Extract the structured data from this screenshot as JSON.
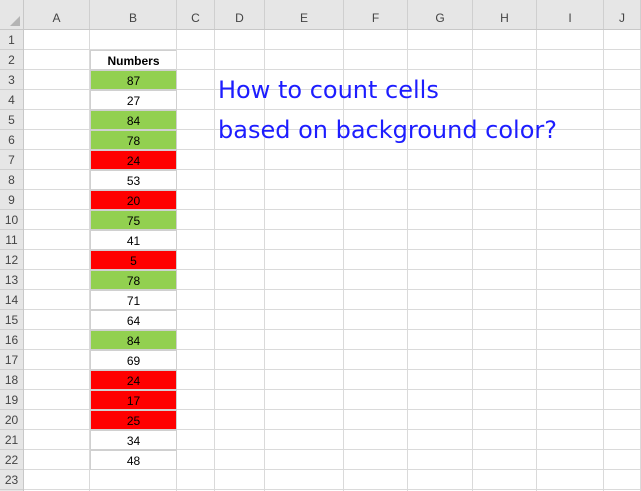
{
  "sheet": {
    "columns": [
      "A",
      "B",
      "C",
      "D",
      "E",
      "F",
      "G",
      "H",
      "I",
      "J"
    ],
    "rows": [
      "1",
      "2",
      "3",
      "4",
      "5",
      "6",
      "7",
      "8",
      "9",
      "10",
      "11",
      "12",
      "13",
      "14",
      "15",
      "16",
      "17",
      "18",
      "19",
      "20",
      "21",
      "22",
      "23"
    ]
  },
  "table": {
    "header": "Numbers",
    "colors": {
      "green": "#92d050",
      "red": "#ff0000",
      "white": "#ffffff"
    },
    "values": [
      {
        "value": "87",
        "color": "green"
      },
      {
        "value": "27",
        "color": "white"
      },
      {
        "value": "84",
        "color": "green"
      },
      {
        "value": "78",
        "color": "green"
      },
      {
        "value": "24",
        "color": "red"
      },
      {
        "value": "53",
        "color": "white"
      },
      {
        "value": "20",
        "color": "red"
      },
      {
        "value": "75",
        "color": "green"
      },
      {
        "value": "41",
        "color": "white"
      },
      {
        "value": "5",
        "color": "red"
      },
      {
        "value": "78",
        "color": "green"
      },
      {
        "value": "71",
        "color": "white"
      },
      {
        "value": "64",
        "color": "white"
      },
      {
        "value": "84",
        "color": "green"
      },
      {
        "value": "69",
        "color": "white"
      },
      {
        "value": "24",
        "color": "red"
      },
      {
        "value": "17",
        "color": "red"
      },
      {
        "value": "25",
        "color": "red"
      },
      {
        "value": "34",
        "color": "white"
      },
      {
        "value": "48",
        "color": "white"
      }
    ]
  },
  "headline": {
    "line1": "How to count cells",
    "line2": "based on background color?",
    "color": "#1d1dff"
  }
}
